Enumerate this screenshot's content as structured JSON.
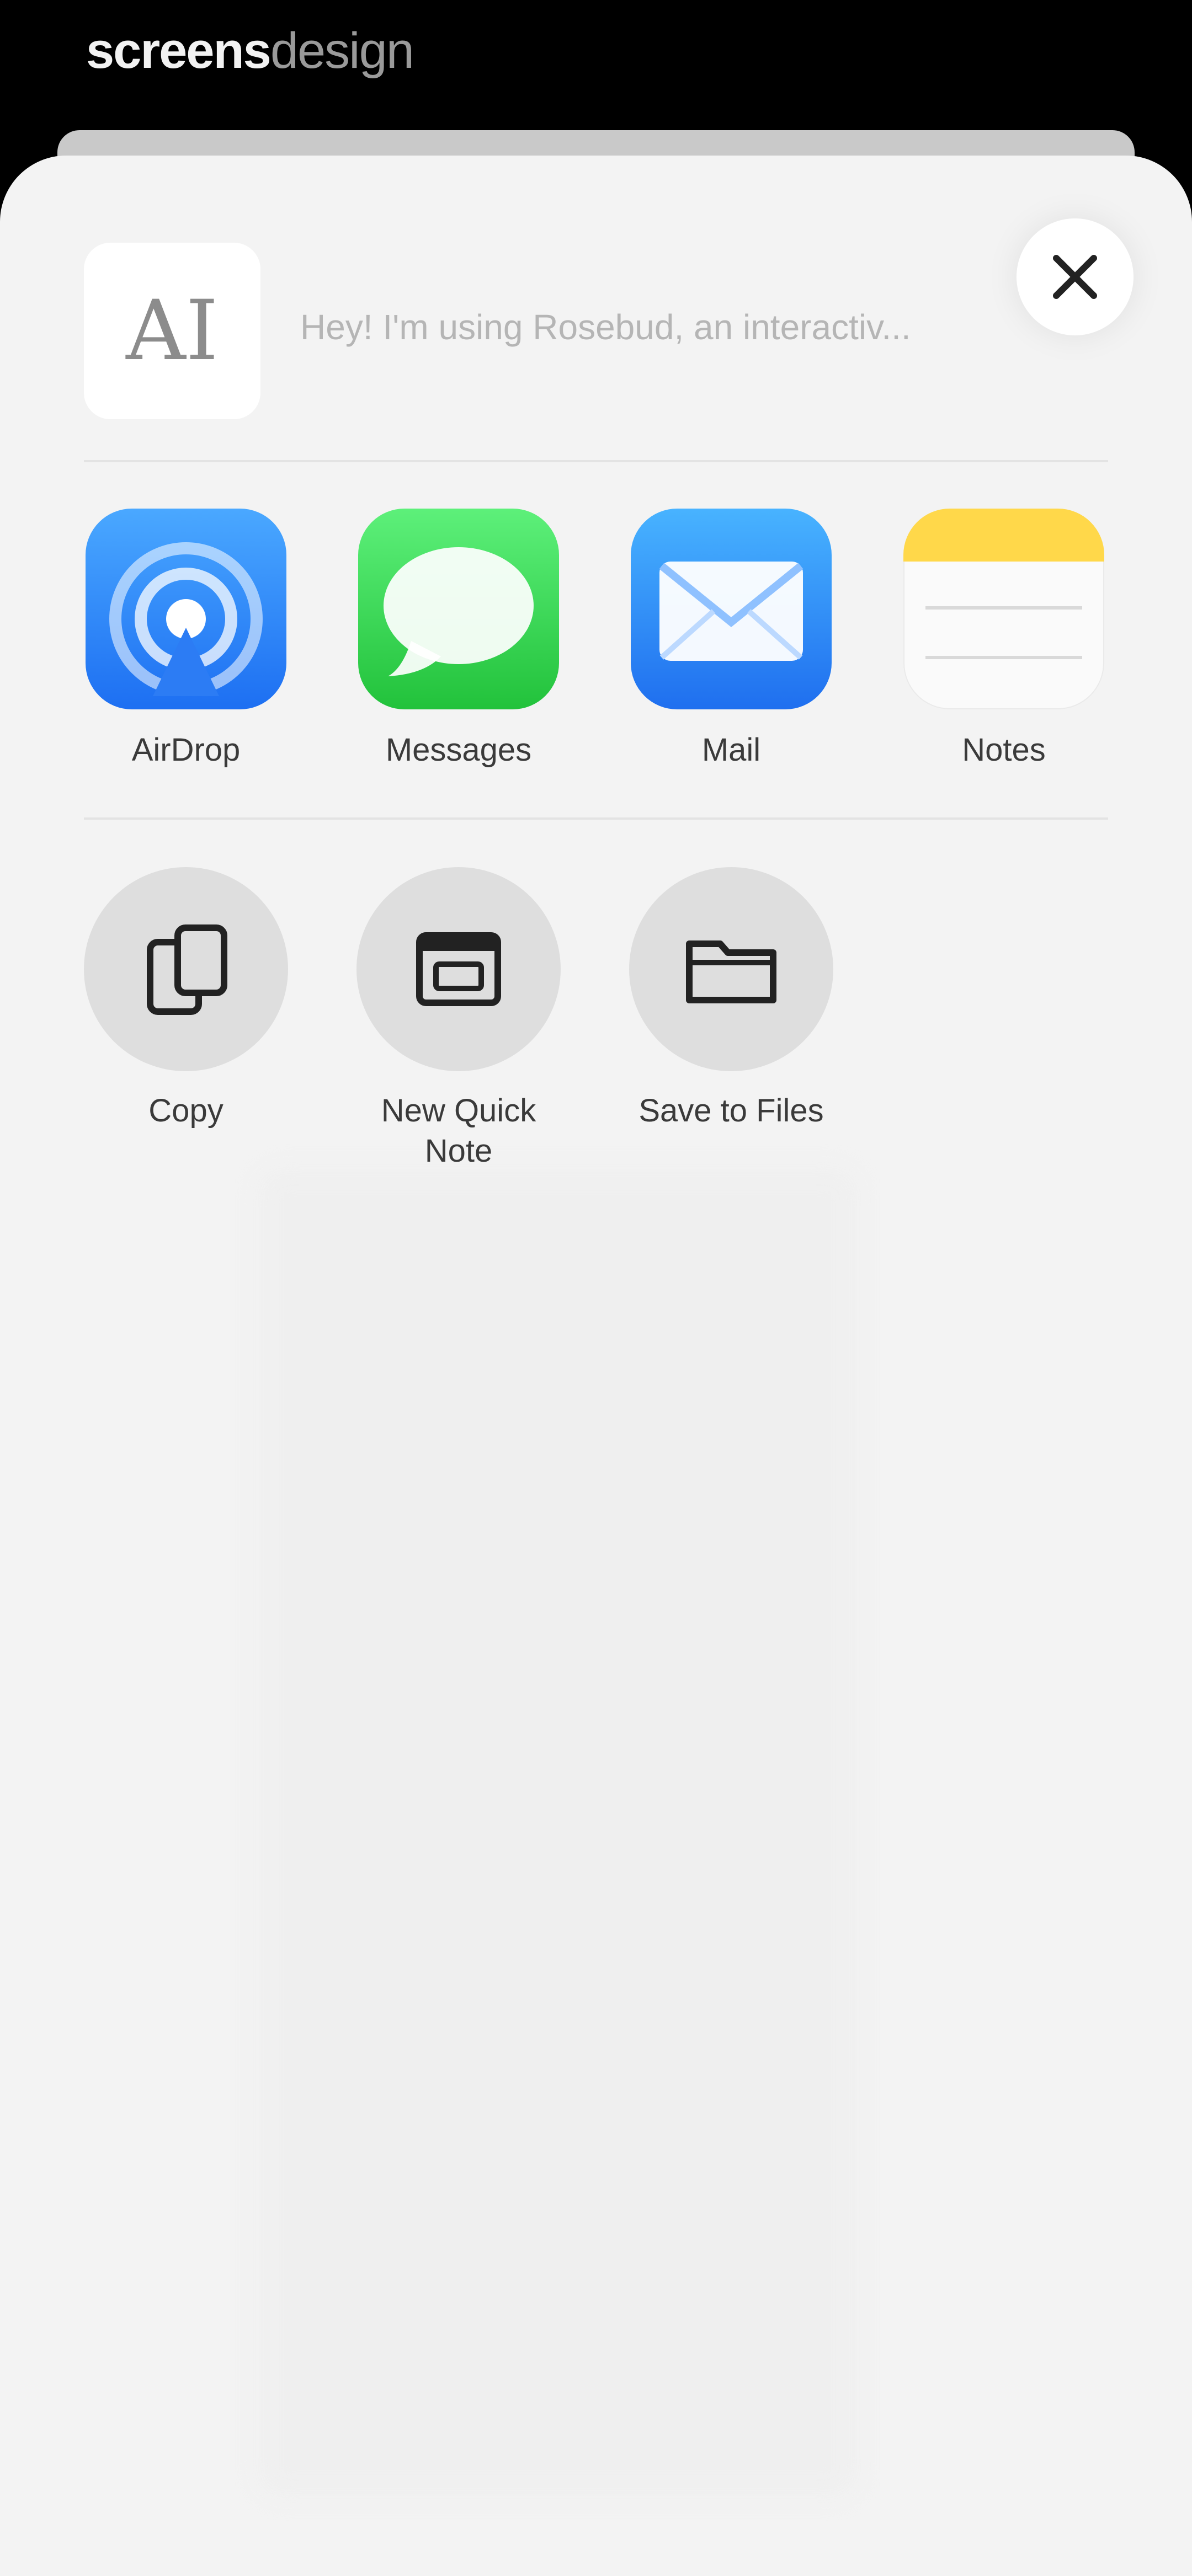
{
  "brand": {
    "part1": "screens",
    "part2": "design"
  },
  "share_header": {
    "thumbnail_text": "AI",
    "text": "Hey! I'm using Rosebud, an interactiv..."
  },
  "apps": [
    {
      "label": "AirDrop",
      "icon": "airdrop-icon"
    },
    {
      "label": "Messages",
      "icon": "messages-icon"
    },
    {
      "label": "Mail",
      "icon": "mail-icon"
    },
    {
      "label": "Notes",
      "icon": "notes-icon"
    }
  ],
  "actions": [
    {
      "label": "Copy",
      "icon": "copy-icon"
    },
    {
      "label": "New Quick Note",
      "icon": "quick-note-icon"
    },
    {
      "label": "Save to Files",
      "icon": "folder-icon"
    }
  ],
  "close_icon": "close-icon"
}
